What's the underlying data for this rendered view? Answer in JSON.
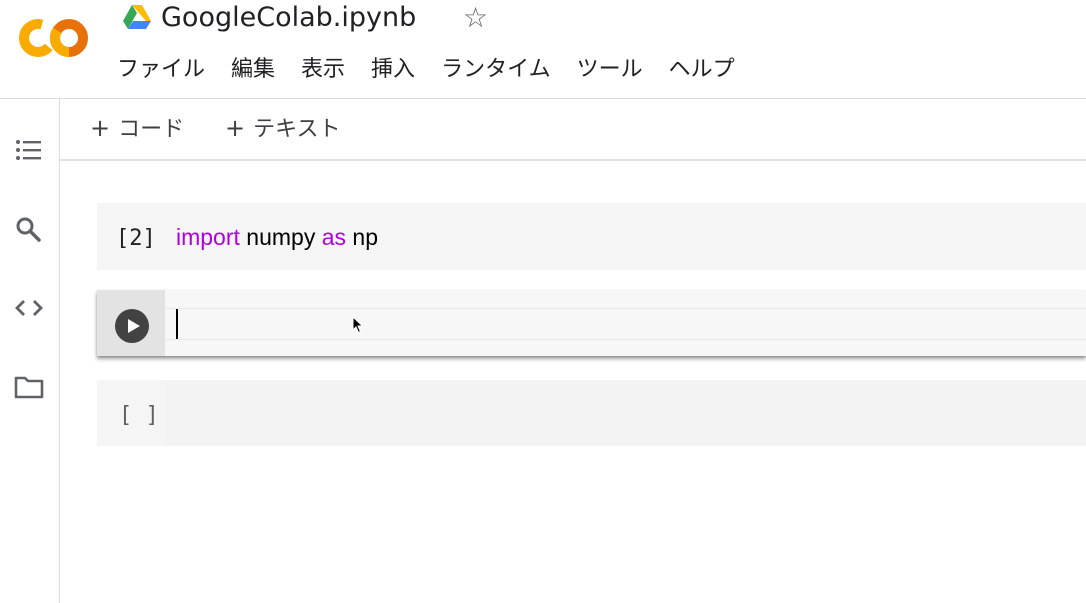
{
  "app": {
    "title": "GoogleColab.ipynb",
    "star": "☆",
    "logo_text": "CO",
    "brand_colors": {
      "orange": "#F9AB00",
      "dark_orange": "#E8710A"
    }
  },
  "menubar": {
    "items": [
      "ファイル",
      "編集",
      "表示",
      "挿入",
      "ランタイム",
      "ツール",
      "ヘルプ"
    ]
  },
  "sidebar": {
    "icons": [
      "toc-icon",
      "search-icon",
      "code-snippets-icon",
      "folder-icon"
    ]
  },
  "toolbar": {
    "plus": "+",
    "add_code_label": "コード",
    "add_text_label": "テキスト"
  },
  "cells": [
    {
      "execution_count": "[2]",
      "code": {
        "kw1": "import",
        "mod": " numpy ",
        "kw2": "as",
        "alias": " np"
      }
    },
    {
      "state": "focused",
      "code": ""
    },
    {
      "execution_count": "[ ]",
      "code": ""
    }
  ],
  "colors": {
    "keyword": "#AF00DB",
    "cell_bg": "#F5F5F5",
    "run_button": "#424242"
  }
}
